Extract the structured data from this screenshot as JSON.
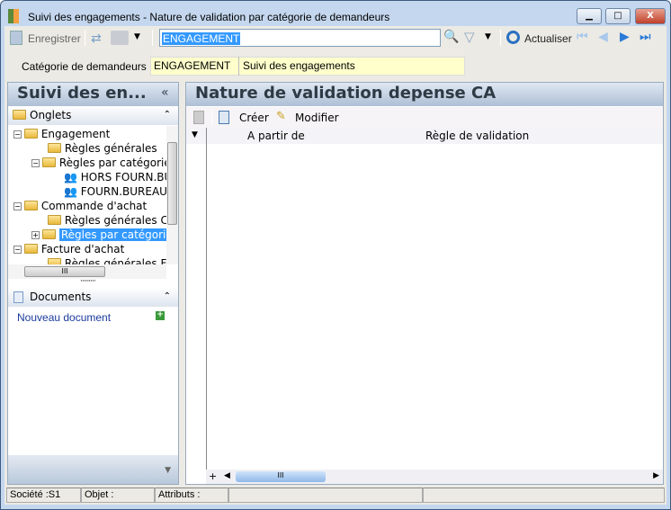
{
  "window": {
    "title": "Suivi des engagements -  Nature de validation par catégorie de demandeurs",
    "minimize": "▁",
    "maximize": "□",
    "close": "X"
  },
  "toolbar": {
    "save": "Enregistrer",
    "search_value": "ENGAGEMENT",
    "refresh": "Actualiser"
  },
  "category": {
    "label": "Catégorie de demandeurs :",
    "code": "ENGAGEMENT",
    "name": "Suivi des engagements"
  },
  "left_pane": {
    "title": "Suivi des en...",
    "collapse": "«",
    "tabs_section": "Onglets",
    "docs_section": "Documents",
    "new_document": "Nouveau document",
    "tree": [
      {
        "label": "Engagement",
        "level": 0
      },
      {
        "label": "Règles générales",
        "level": 1
      },
      {
        "label": "Règles par catégorie",
        "level": 1
      },
      {
        "label": "HORS FOURN.BUREAU",
        "level": 2
      },
      {
        "label": "FOURN.BUREAU",
        "level": 2
      },
      {
        "label": "Commande d'achat",
        "level": 0
      },
      {
        "label": "Règles générales CA",
        "level": 1
      },
      {
        "label": "Règles par catégorie",
        "level": 1,
        "selected": true
      },
      {
        "label": "Facture d'achat",
        "level": 0
      },
      {
        "label": "Règles générales FA",
        "level": 1
      }
    ]
  },
  "right_pane": {
    "title": "Nature de validation depense CA",
    "create": "Créer",
    "modify": "Modifier",
    "columns": [
      "A partir de",
      "Règle de validation"
    ]
  },
  "status": {
    "company": "Société :S1",
    "object": "Objet :",
    "attributes": "Attributs :"
  },
  "colors": {
    "selection": "#3399ff",
    "category_bg": "#ffffcc"
  }
}
